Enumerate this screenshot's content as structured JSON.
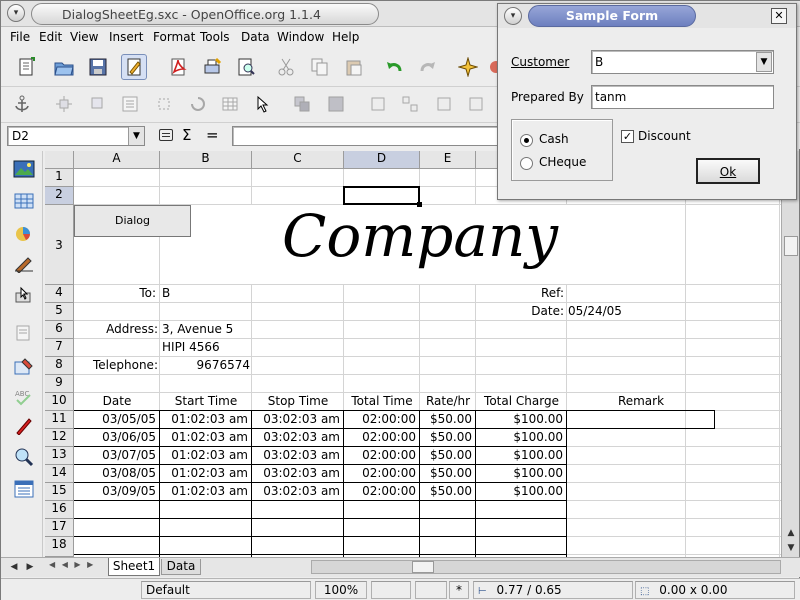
{
  "window": {
    "title": "DialogSheetEg.sxc - OpenOffice.org 1.1.4"
  },
  "menu": [
    "File",
    "Edit",
    "View",
    "Insert",
    "Format",
    "Tools",
    "Data",
    "Window",
    "Help"
  ],
  "formula_bar": {
    "name_box": "D2",
    "formula_value": ""
  },
  "columns": [
    "A",
    "B",
    "C",
    "D",
    "E"
  ],
  "rows": [
    "1",
    "2",
    "3",
    "4",
    "5",
    "6",
    "7",
    "8",
    "9",
    "10",
    "11",
    "12",
    "13",
    "14",
    "15",
    "16",
    "17",
    "18"
  ],
  "sheet": {
    "dialog_button_label": "Dialog",
    "company_title": "Company",
    "to_label": "To:",
    "to_value": "B",
    "ref_label": "Ref:",
    "date_label": "Date:",
    "date_value": "05/24/05",
    "address_label": "Address:",
    "address_line1": "3, Avenue 5",
    "address_line2": "HIPI 4566",
    "telephone_label": "Telephone:",
    "telephone_value": "9676574",
    "table_headers": [
      "Date",
      "Start Time",
      "Stop Time",
      "Total Time",
      "Rate/hr",
      "Total Charge",
      "Remark"
    ],
    "table_rows": [
      [
        "03/05/05",
        "01:02:03 am",
        "03:02:03 am",
        "02:00:00",
        "$50.00",
        "$100.00",
        ""
      ],
      [
        "03/06/05",
        "01:02:03 am",
        "03:02:03 am",
        "02:00:00",
        "$50.00",
        "$100.00",
        ""
      ],
      [
        "03/07/05",
        "01:02:03 am",
        "03:02:03 am",
        "02:00:00",
        "$50.00",
        "$100.00",
        ""
      ],
      [
        "03/08/05",
        "01:02:03 am",
        "03:02:03 am",
        "02:00:00",
        "$50.00",
        "$100.00",
        ""
      ],
      [
        "03/09/05",
        "01:02:03 am",
        "03:02:03 am",
        "02:00:00",
        "$50.00",
        "$100.00",
        ""
      ]
    ]
  },
  "tabs": [
    "Sheet1",
    "Data"
  ],
  "status": {
    "page_style": "Default",
    "zoom": "100%",
    "mode": "*",
    "position": "0.77 / 0.65",
    "size": "0.00 x 0.00"
  },
  "dialog": {
    "title": "Sample Form",
    "customer_label": "Customer",
    "customer_value": "B",
    "prepared_by_label": "Prepared By",
    "prepared_by_value": "tanm",
    "cash_label": "Cash",
    "cheque_label": "CHeque",
    "discount_label": "Discount",
    "ok_label": "Ok"
  }
}
